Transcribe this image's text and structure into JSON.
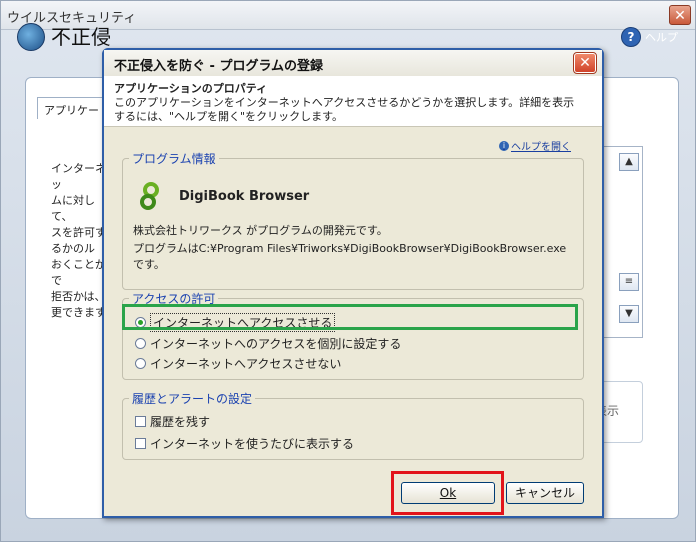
{
  "outer": {
    "title": "ウイルスセキュリティ",
    "heading": "不正侵",
    "help_label": "ヘルプ",
    "tab_label": "アプリケー",
    "desc_lines": [
      "インターネッ",
      "ムに対して、",
      "スを許可す",
      "るかのル",
      "おくことがで",
      "拒否かは、",
      "更できます"
    ],
    "box_text": "表示"
  },
  "dialog": {
    "title": "不正侵入を防ぐ - プログラムの登録",
    "close_glyph": "✕",
    "info_title": "アプリケーションのプロパティ",
    "info_text": "このアプリケーションをインターネットへアクセスさせるかどうかを選択します。詳細を表示するには、\"ヘルプを開く\"をクリックします。",
    "help_open_label": "ヘルプを開く",
    "program_group": {
      "title": "プログラム情報",
      "program_name": "DigiBook Browser",
      "developer_line": "株式会社トリワークス がプログラムの開発元です。",
      "path_line1": "プログラムはC:¥Program Files¥Triworks¥DigiBookBrowser¥DigiBookBrowser.exe",
      "path_line2": "です。"
    },
    "access_group": {
      "title": "アクセスの許可",
      "options": [
        {
          "label": "インターネットへアクセスさせる",
          "selected": true
        },
        {
          "label": "インターネットへのアクセスを個別に設定する",
          "selected": false
        },
        {
          "label": "インターネットへアクセスさせない",
          "selected": false
        }
      ]
    },
    "history_group": {
      "title": "履歴とアラートの設定",
      "checks": [
        {
          "label": "履歴を残す",
          "checked": false
        },
        {
          "label": "インターネットを使うたびに表示する",
          "checked": false
        }
      ]
    },
    "ok_label": "Ok",
    "cancel_label": "キャンセル"
  },
  "colors": {
    "dialog_border": "#2e5ea8",
    "group_title": "#1c43b0",
    "green_highlight": "#2aa44a",
    "red_highlight": "#e2141b"
  }
}
